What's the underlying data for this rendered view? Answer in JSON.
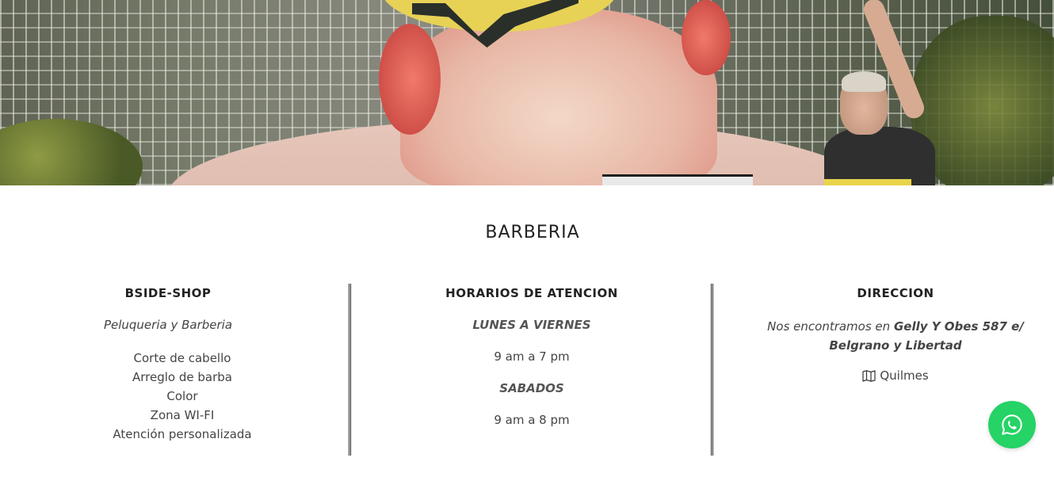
{
  "section": {
    "title": "BARBERIA"
  },
  "columns": {
    "shop": {
      "heading": "BSIDE-SHOP",
      "subtitle": "Peluqueria y Barberia",
      "services": [
        "Corte de cabello",
        "Arreglo de barba",
        "Color",
        "Zona WI-FI",
        "Atención personalizada"
      ]
    },
    "hours": {
      "heading": "HORARIOS DE ATENCION",
      "weekdays_label": "LUNES A VIERNES",
      "weekdays_hours": "9 am a 7 pm",
      "saturday_label": "SABADOS",
      "saturday_hours": "9 am a 8 pm"
    },
    "address": {
      "heading": "DIRECCION",
      "intro": "Nos encontramos en",
      "street": "Gelly Y Obes 587 e/ Belgrano y Libertad",
      "city": "Quilmes",
      "city_icon": "map-icon"
    }
  },
  "whatsapp": {
    "icon": "whatsapp-icon",
    "color": "#25d366"
  }
}
